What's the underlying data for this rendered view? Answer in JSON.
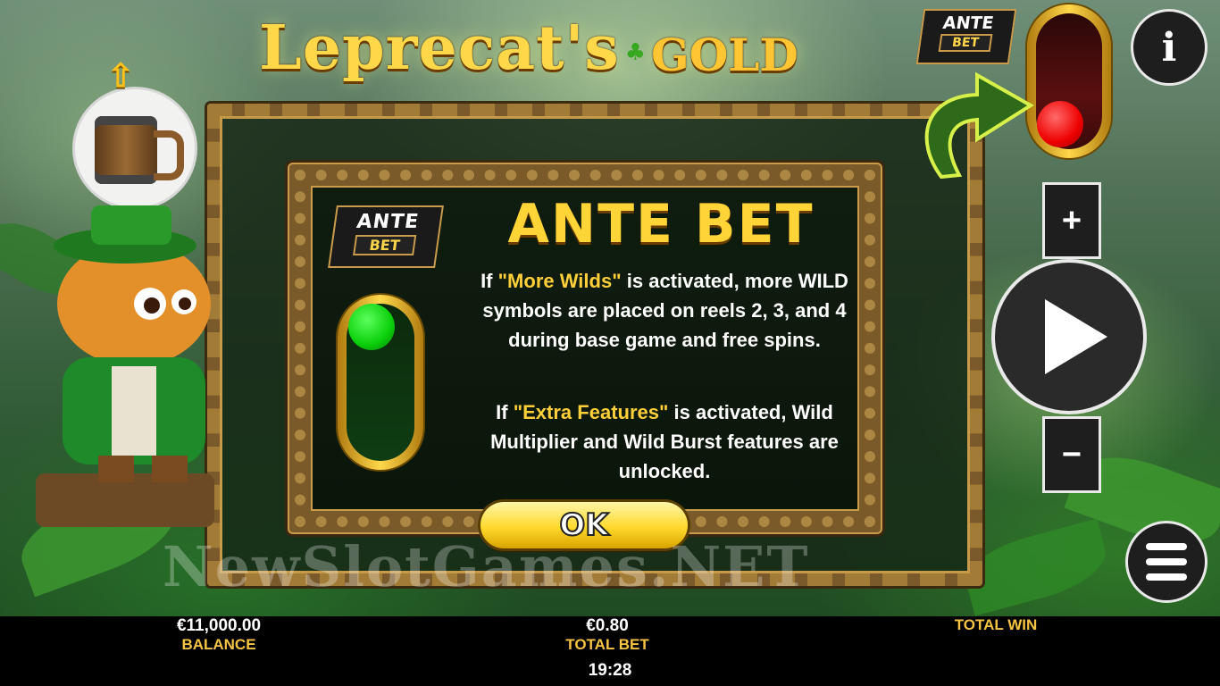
{
  "game": {
    "title_main": "Leprecat's",
    "title_gold": "GOLD",
    "watermark": "NewSlotGames.NET"
  },
  "ante_badge": {
    "line1": "ANTE",
    "line2": "BET"
  },
  "dialog": {
    "badge": {
      "line1": "ANTE",
      "line2": "BET"
    },
    "title": "ANTE BET",
    "toggle_state": "on",
    "paragraph1": {
      "prefix": "If ",
      "highlight": "\"More Wilds\"",
      "rest": " is activated, more WILD symbols are placed on reels 2, 3, and 4 during base game and free spins."
    },
    "paragraph2": {
      "prefix": "If ",
      "highlight": "\"Extra Features\"",
      "rest": " is activated, Wild Multiplier and Wild Burst features are unlocked."
    },
    "ok_label": "OK"
  },
  "controls": {
    "info_label": "i",
    "plus_label": "+",
    "minus_label": "−",
    "ante_toggle_state": "off"
  },
  "status": {
    "balance_value": "€11,000.00",
    "balance_label": "BALANCE",
    "bet_value": "€0.80",
    "bet_label": "TOTAL BET",
    "win_value": "",
    "win_label": "TOTAL WIN",
    "clock": "19:28"
  },
  "colors": {
    "accent_gold": "#ffd437",
    "toggle_on": "#0bcf0b",
    "toggle_off": "#ee0000"
  }
}
